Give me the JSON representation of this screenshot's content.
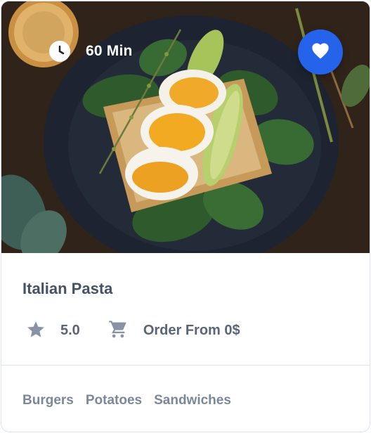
{
  "card": {
    "cook_time": "60 Min",
    "title": "Italian Pasta",
    "rating": "5.0",
    "order_label": "Order From 0$",
    "tags": [
      "Burgers",
      "Potatoes",
      "Sandwiches"
    ]
  },
  "icons": {
    "time": "clock-icon",
    "favorite": "heart-icon",
    "rating": "star-icon",
    "order": "cart-icon"
  },
  "colors": {
    "accent": "#2563eb",
    "title": "#475166",
    "meta_text": "#5b6478",
    "tag_text": "#7d879b",
    "icon_gray": "#8a93a6",
    "border": "#dfe3ec"
  }
}
